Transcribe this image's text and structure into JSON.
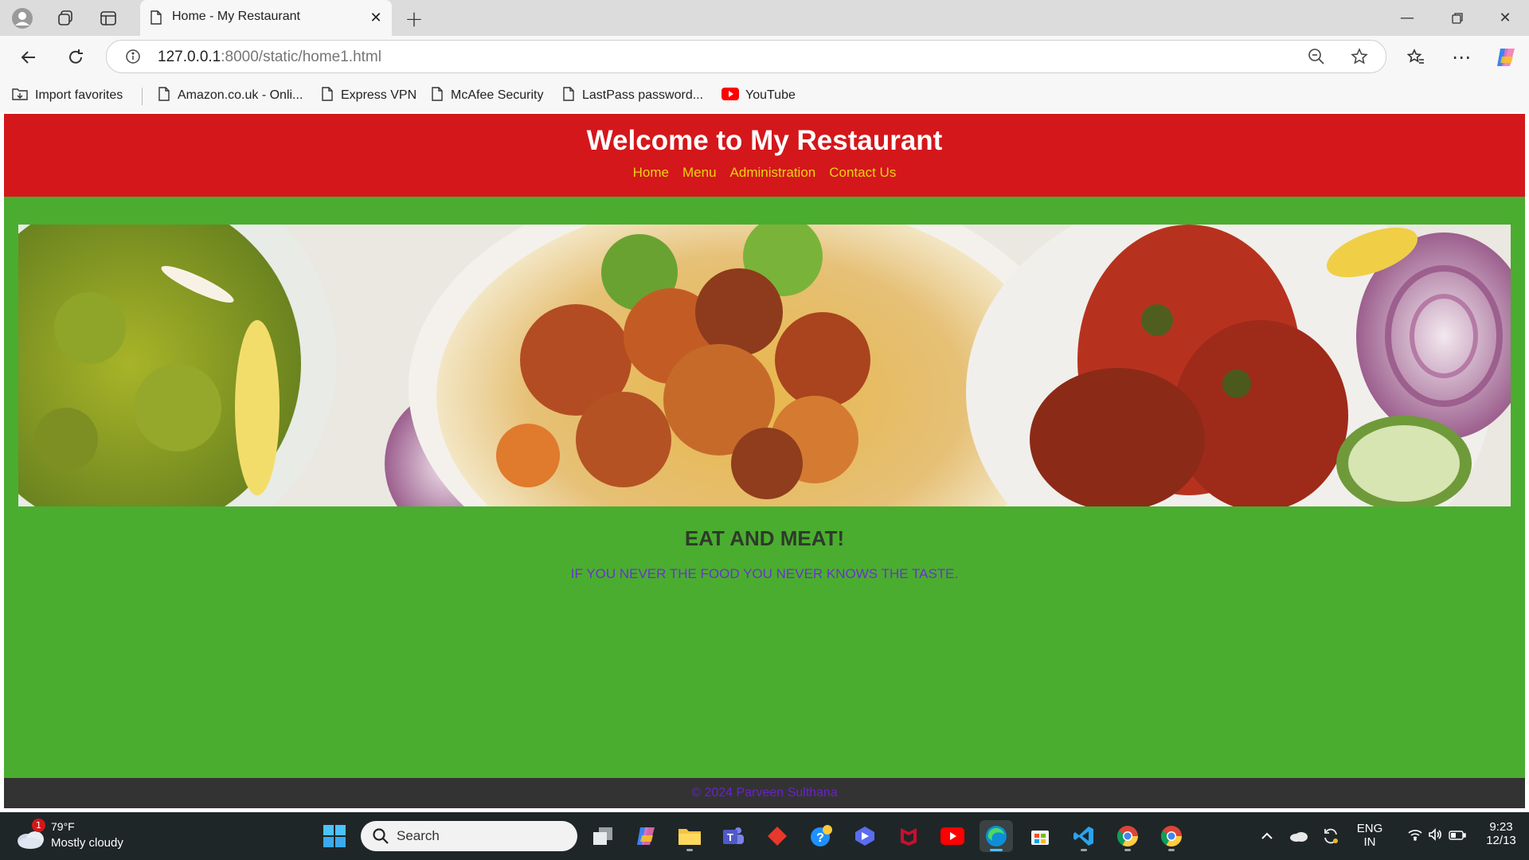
{
  "browser": {
    "tab_title": "Home - My Restaurant",
    "url_host": "127.0.0.1",
    "url_rest": ":8000/static/home1.html",
    "bookmarks": [
      {
        "label": "Import favorites",
        "icon": "import-icon"
      },
      {
        "label": "Amazon.co.uk - Onli...",
        "icon": "page-icon"
      },
      {
        "label": "Express VPN",
        "icon": "page-icon"
      },
      {
        "label": "McAfee Security",
        "icon": "page-icon"
      },
      {
        "label": "LastPass password...",
        "icon": "page-icon"
      },
      {
        "label": "YouTube",
        "icon": "youtube-icon"
      }
    ]
  },
  "page": {
    "title": "Welcome to My Restaurant",
    "nav": [
      "Home",
      "Menu",
      "Administration",
      "Contact Us"
    ],
    "tagline_title": "EAT AND MEAT!",
    "tagline_sub": "IF YOU NEVER THE FOOD YOU NEVER KNOWS THE TASTE.",
    "footer": "© 2024 Parveen Sulthana",
    "colors": {
      "header_bg": "#d4171b",
      "nav_link": "#e5d60c",
      "body_bg": "#4aad2f",
      "footer_bg": "#333333",
      "tagline_sub": "#6a33d0"
    }
  },
  "taskbar": {
    "weather_badge": "1",
    "weather_temp": "79°F",
    "weather_desc": "Mostly cloudy",
    "search_placeholder": "Search",
    "lang_line1": "ENG",
    "lang_line2": "IN",
    "time": "9:23",
    "date": "12/13"
  }
}
